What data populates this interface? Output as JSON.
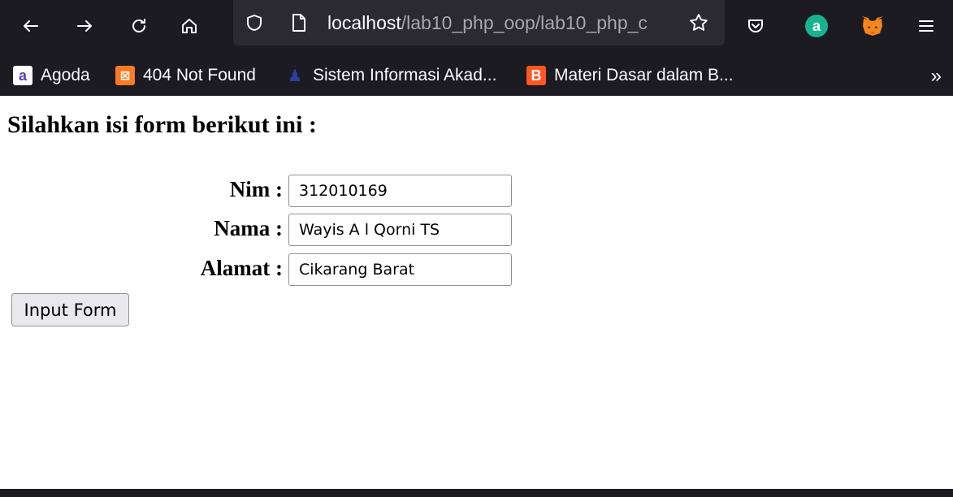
{
  "browser": {
    "url_host": "localhost",
    "url_path": "/lab10_php_oop/lab10_php_c",
    "bookmarks": [
      {
        "label": "Agoda",
        "icon": "agoda-icon",
        "color": "#5b3fb1"
      },
      {
        "label": "404 Not Found",
        "icon": "xampp-icon",
        "color": "#fb7a24"
      },
      {
        "label": "Sistem Informasi Akad...",
        "icon": "university-logo-icon",
        "color": "#2a3f9e"
      },
      {
        "label": "Materi Dasar dalam B...",
        "icon": "blogger-icon",
        "color": "#ff5722"
      }
    ],
    "extension_colors": {
      "amazon": "#19b48f",
      "metamask": "#f6851b"
    }
  },
  "form": {
    "heading": "Silahkan isi form berikut ini :",
    "fields": [
      {
        "label": "Nim :",
        "value": "312010169"
      },
      {
        "label": "Nama :",
        "value": "Wayis A l Qorni TS"
      },
      {
        "label": "Alamat :",
        "value": "Cikarang Barat"
      }
    ],
    "submit_label": "Input Form"
  }
}
